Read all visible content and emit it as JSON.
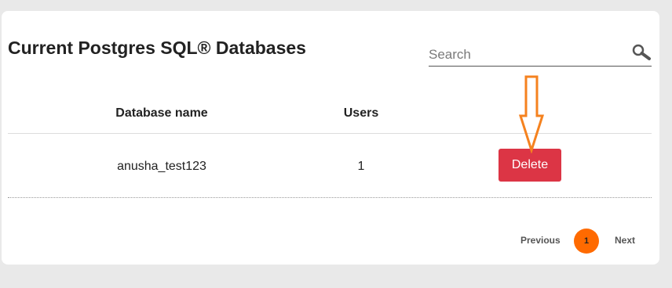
{
  "header": {
    "title": "Current Postgres SQL® Databases"
  },
  "search": {
    "placeholder": "Search",
    "value": "",
    "icon": "search-icon"
  },
  "table": {
    "columns": [
      "Database name",
      "Users"
    ],
    "rows": [
      {
        "database_name": "anusha_test123",
        "users": "1",
        "action_label": "Delete"
      }
    ]
  },
  "pagination": {
    "previous_label": "Previous",
    "current_page": "1",
    "next_label": "Next"
  },
  "colors": {
    "delete_button": "#dc3545",
    "page_active": "#ff6a00",
    "annotation_arrow": "#f5821f"
  }
}
